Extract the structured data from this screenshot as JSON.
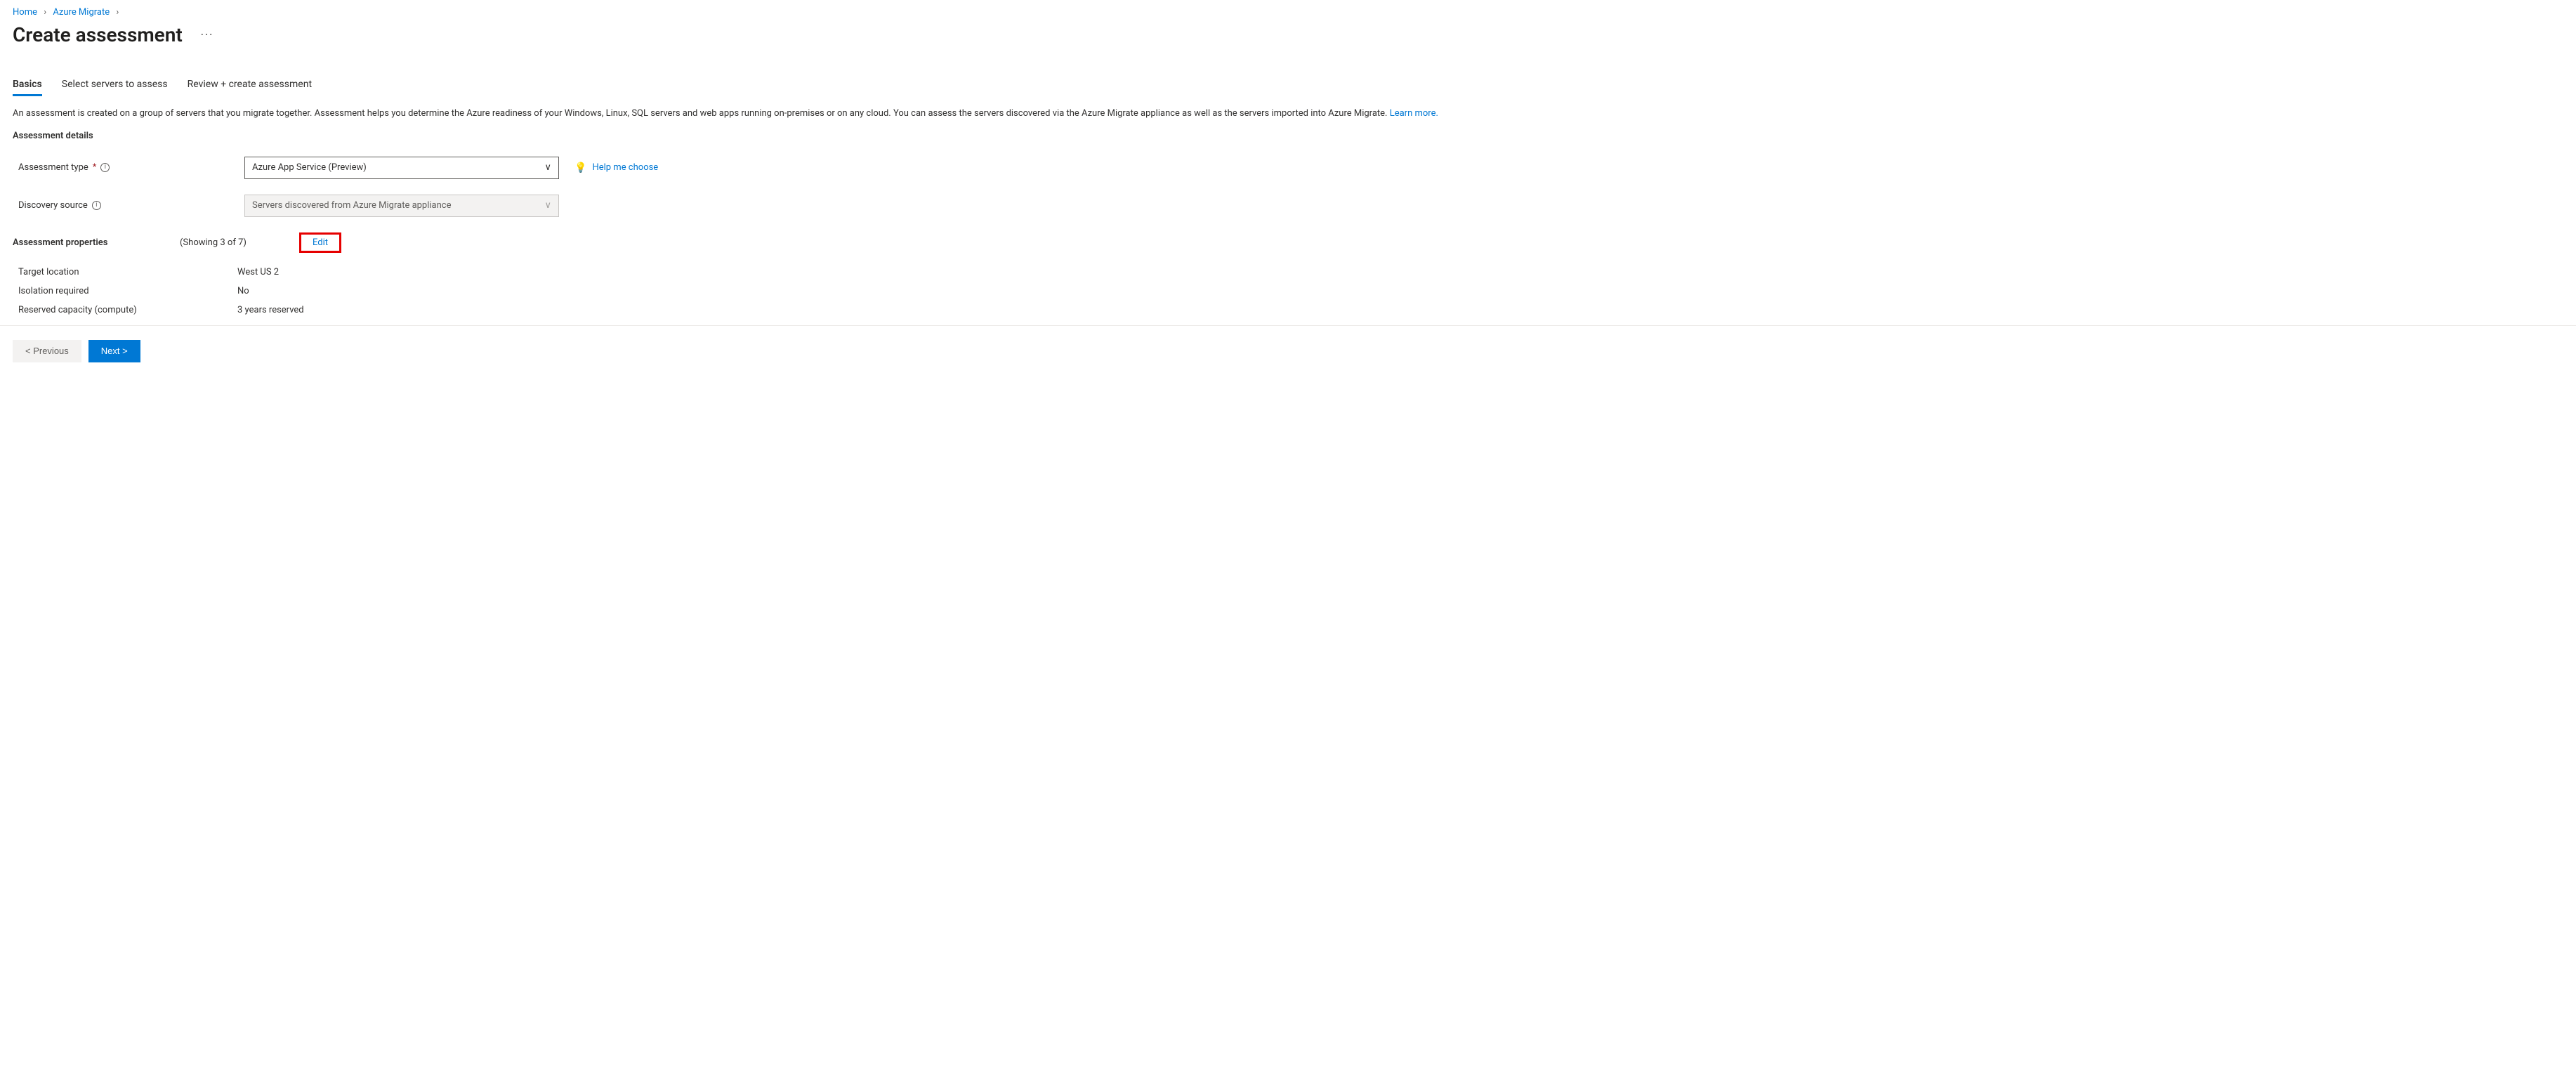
{
  "breadcrumb": {
    "items": [
      "Home",
      "Azure Migrate"
    ]
  },
  "page_title": "Create assessment",
  "more_icon": "···",
  "tabs": [
    {
      "label": "Basics",
      "active": true
    },
    {
      "label": "Select servers to assess",
      "active": false
    },
    {
      "label": "Review + create assessment",
      "active": false
    }
  ],
  "intro": {
    "text": "An assessment is created on a group of servers that you migrate together. Assessment helps you determine the Azure readiness of your Windows, Linux, SQL servers and web apps running on-premises or on any cloud. You can assess the servers discovered via the Azure Migrate appliance as well as the servers imported into Azure Migrate. ",
    "learn_more": "Learn more."
  },
  "sections": {
    "details_label": "Assessment details",
    "properties_label": "Assessment properties"
  },
  "fields": {
    "assessment_type": {
      "label": "Assessment type",
      "value": "Azure App Service (Preview)",
      "help_link": "Help me choose"
    },
    "discovery_source": {
      "label": "Discovery source",
      "value": "Servers discovered from Azure Migrate appliance"
    }
  },
  "properties": {
    "showing_text": "(Showing 3 of 7)",
    "edit_label": "Edit",
    "items": [
      {
        "key": "Target location",
        "value": "West US 2"
      },
      {
        "key": "Isolation required",
        "value": "No"
      },
      {
        "key": "Reserved capacity (compute)",
        "value": "3 years reserved"
      }
    ]
  },
  "footer": {
    "prev": "< Previous",
    "next": "Next >"
  },
  "glyphs": {
    "chevron_right": "›",
    "chevron_down": "∨",
    "info": "i",
    "bulb": "💡"
  }
}
